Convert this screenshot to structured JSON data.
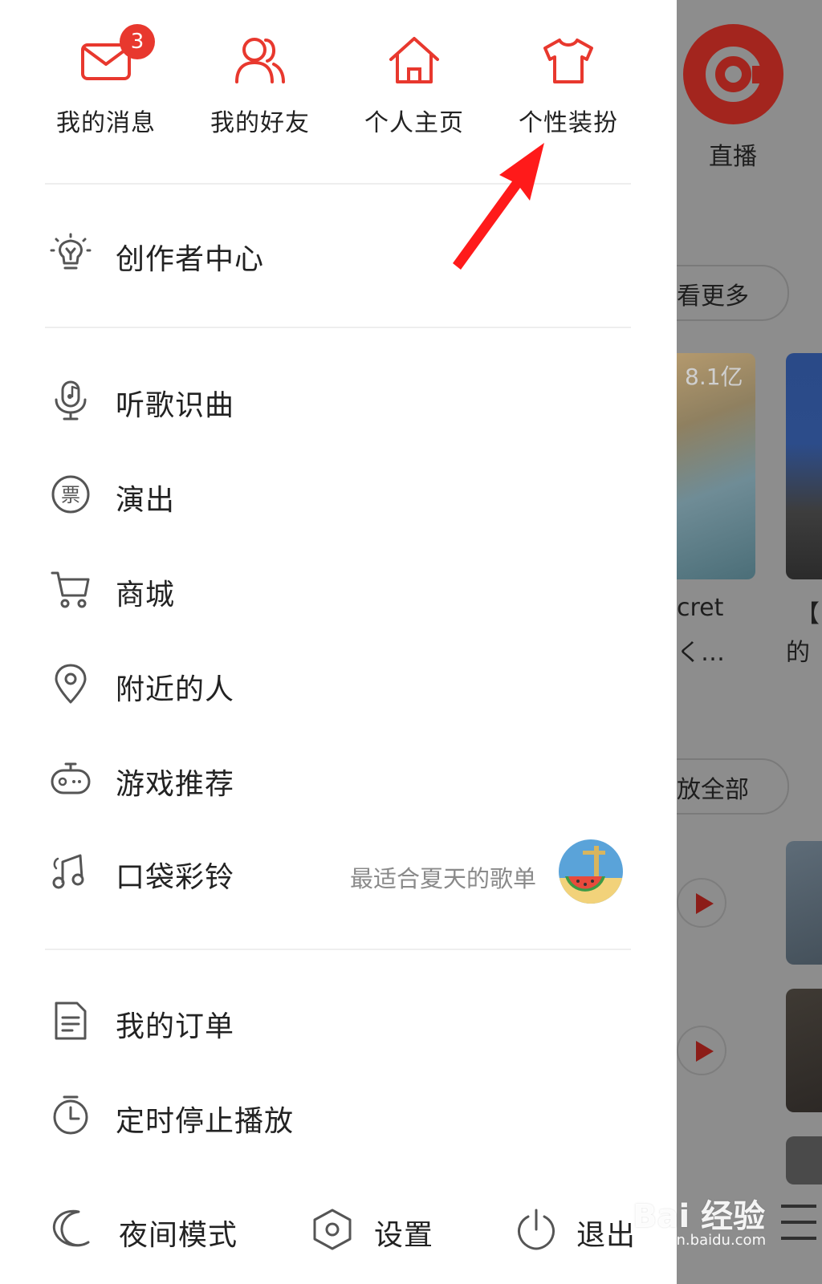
{
  "drawer": {
    "quick_actions": [
      {
        "label": "我的消息",
        "icon": "mail-icon",
        "badge": "3"
      },
      {
        "label": "我的好友",
        "icon": "friends-icon"
      },
      {
        "label": "个人主页",
        "icon": "home-icon"
      },
      {
        "label": "个性装扮",
        "icon": "tshirt-icon"
      }
    ],
    "creator_center": "创作者中心",
    "menu_items": [
      {
        "label": "听歌识曲",
        "icon": "microphone-note-icon"
      },
      {
        "label": "演出",
        "icon": "ticket-icon"
      },
      {
        "label": "商城",
        "icon": "cart-icon"
      },
      {
        "label": "附近的人",
        "icon": "location-pin-icon"
      },
      {
        "label": "游戏推荐",
        "icon": "game-controller-icon"
      },
      {
        "label": "口袋彩铃",
        "icon": "ringtone-note-icon",
        "subtitle": "最适合夏天的歌单"
      }
    ],
    "bottom_items": [
      {
        "label": "我的订单",
        "icon": "document-icon"
      },
      {
        "label": "定时停止播放",
        "icon": "timer-icon"
      }
    ],
    "footer": {
      "night_mode": "夜间模式",
      "settings": "设置",
      "exit": "退出"
    }
  },
  "background": {
    "live": "直播",
    "see_more": "看更多",
    "play_count": "8.1亿",
    "card_title_1": "cret",
    "card_title_2": "く…",
    "card_title_3": "【",
    "card_title_4": "的",
    "play_all": "放全部"
  },
  "watermark": {
    "brand": "Bai 经验",
    "url": "jingyan.baidu.com"
  },
  "colors": {
    "accent": "#e8382e",
    "arrow": "#ff1a1a",
    "text": "#222222",
    "subtext": "#8a8a8a"
  }
}
